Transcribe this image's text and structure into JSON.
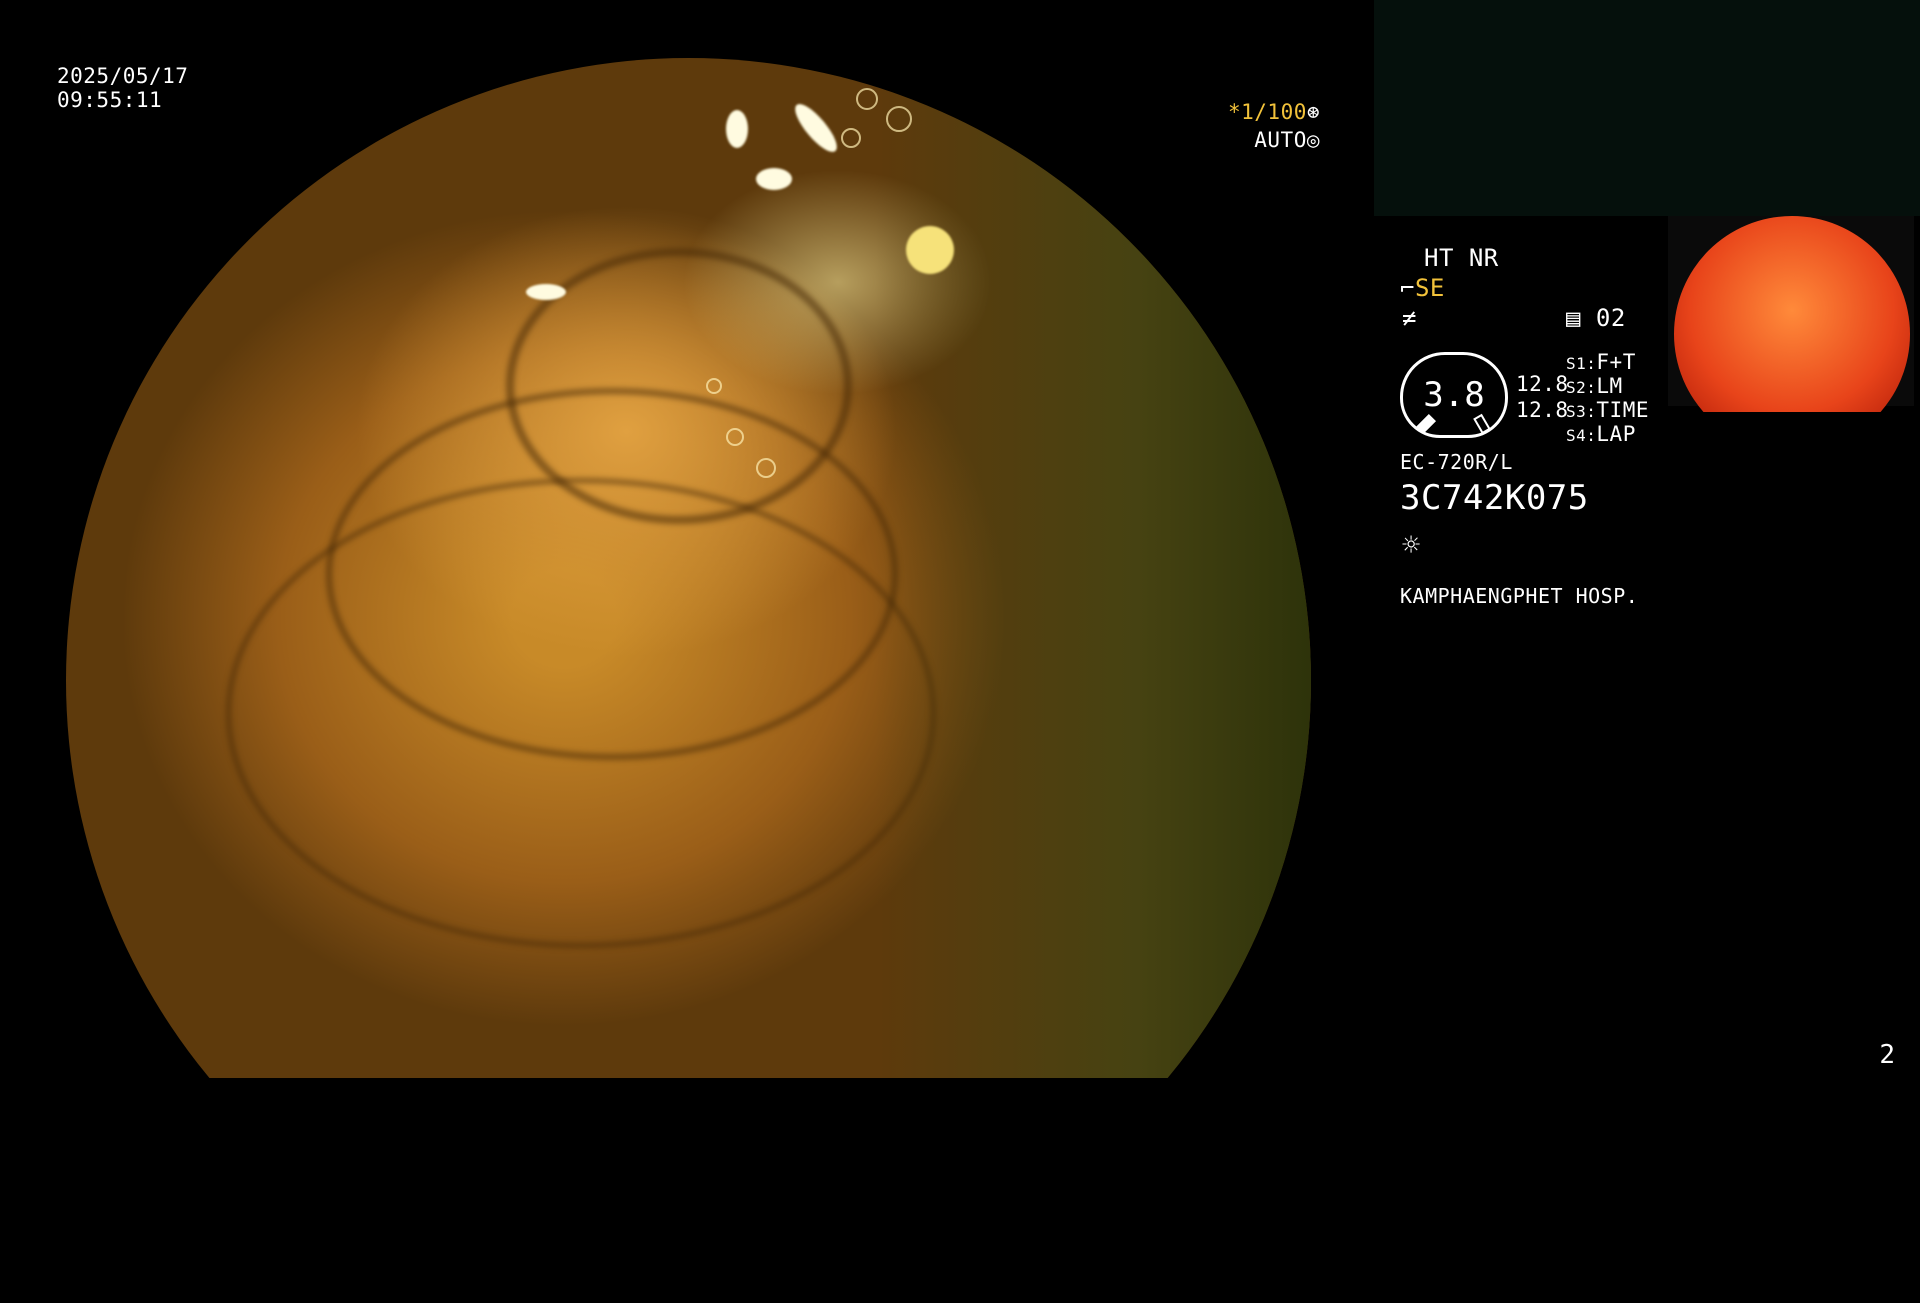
{
  "datetime": {
    "date": "2025/05/17",
    "time": "09:55:11"
  },
  "exposure": {
    "shutter": "*1/100",
    "mode": "AUTO",
    "shutter_icon": "aperture-icon",
    "mode_icon": "iris-icon"
  },
  "settings": {
    "ht_nr": "HT NR",
    "se": "SE",
    "se_icon": "enhance-icon",
    "flash_icon": "lightning-icon",
    "memory_icon": "memory-card-icon",
    "memory_count": "02"
  },
  "gauge": {
    "value": "3.8",
    "top_reading": "12.8",
    "bottom_reading": "12.8"
  },
  "switches": [
    {
      "key": "S1:",
      "value": "F+T"
    },
    {
      "key": "S2:",
      "value": "LM"
    },
    {
      "key": "S3:",
      "value": "TIME"
    },
    {
      "key": "S4:",
      "value": "LAP"
    }
  ],
  "scope": {
    "model": "EC-720R/L",
    "serial": "3C742K075",
    "light_icon": "sun-icon"
  },
  "hospital": "KAMPHAENGPHET HOSP.",
  "page_number": "2",
  "colors": {
    "accent_yellow": "#f2c23a",
    "text": "#ffffff",
    "background": "#000000"
  }
}
